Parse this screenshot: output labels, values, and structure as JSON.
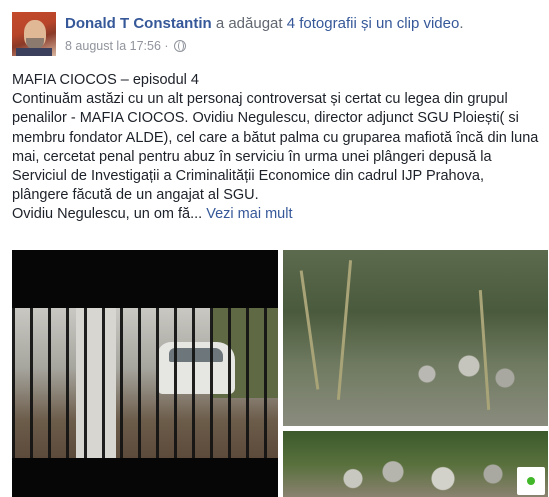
{
  "post": {
    "author": "Donald T Constantin",
    "action_prefix": " a adăugat ",
    "action_link": "4 fotografii și un clip video",
    "action_suffix": ".",
    "timestamp": "8 august la 17:56",
    "meta_sep": " · ",
    "privacy_icon": "globe-icon",
    "title_line": "MAFIA CIOCOS – episodul 4",
    "body": "Continuăm astăzi cu un alt personaj controversat și certat cu legea din grupul penalilor - MAFIA CIOCOS. Ovidiu Negulescu, director adjunct SGU Ploiești( si membru fondator ALDE), cel care a bătut palma cu gruparea mafiotă încă din luna mai, cercetat penal pentru abuz în serviciu în urma unei plângeri depusă la Serviciul de Investigații a Criminalității Economice din cadrul IJP Prahova, plângere făcută de un angajat al SGU.",
    "truncated_line": "Ovidiu Negulescu, un om fă...",
    "see_more": "Vezi mai mult"
  },
  "status": {
    "online_color": "#42b72a"
  }
}
